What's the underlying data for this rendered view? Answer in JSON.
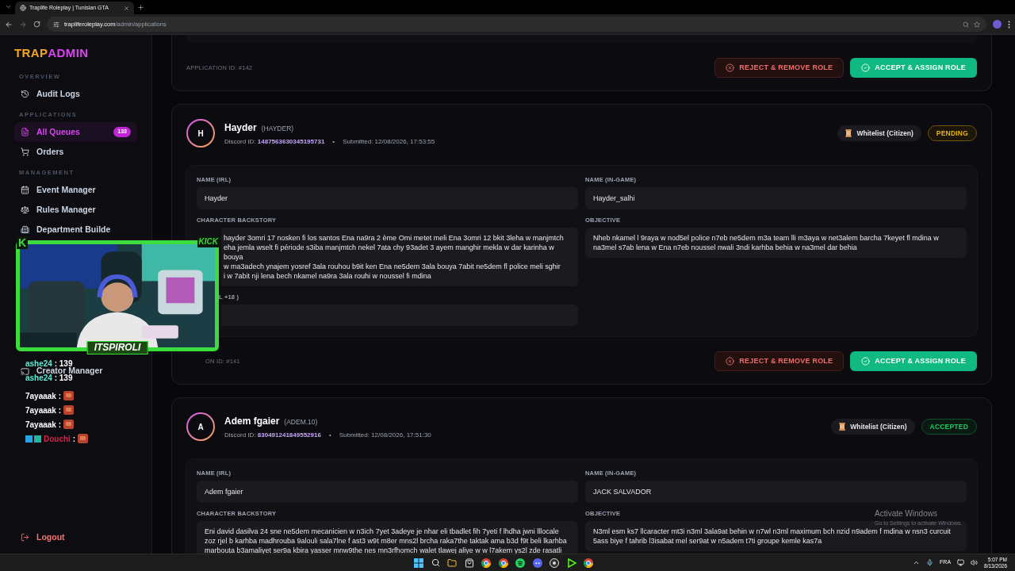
{
  "browser": {
    "tab_title": "Traplife Roleplay | Tunisian GTA",
    "url_host": "trapliferoleplay.com",
    "url_path": "/admin/applications"
  },
  "brand": {
    "part1": "TRAP",
    "part2": "ADMIN"
  },
  "sidebar": {
    "sections": [
      {
        "heading": "OVERVIEW",
        "items": [
          {
            "label": "Audit Logs",
            "selected": false
          }
        ]
      },
      {
        "heading": "APPLICATIONS",
        "items": [
          {
            "label": "All Queues",
            "selected": true,
            "badge": "133"
          },
          {
            "label": "Orders",
            "selected": false
          }
        ]
      },
      {
        "heading": "MANAGEMENT",
        "items": [
          {
            "label": "Event Manager",
            "selected": false
          },
          {
            "label": "Rules Manager",
            "selected": false
          },
          {
            "label": "Department Builde",
            "selected": false
          },
          {
            "label": "Creator Manager",
            "selected": false,
            "after_hidden": true
          }
        ]
      }
    ],
    "logout": "Logout"
  },
  "applications": [
    {
      "kind": "partial",
      "application_id": "APPLICATION ID: #142",
      "actions": {
        "reject": "REJECT & REMOVE ROLE",
        "accept": "ACCEPT & ASSIGN ROLE"
      }
    },
    {
      "kind": "full",
      "occluded": true,
      "initial": "H",
      "name": "Hayder",
      "handle": "(HAYDER)",
      "discord_label": "Discord ID:",
      "discord_id": "1487563630345195731",
      "separator": "•",
      "submitted": "Submitted: 12/08/2026, 17:53:55",
      "type": "Whitelist (Citizen)",
      "status": {
        "label": "PENDING",
        "kind": "pending"
      },
      "left": [
        {
          "label": "NAME (IRL)",
          "value": "Hayder",
          "multiline": false
        },
        {
          "label": "CHARACTER BACKSTORY",
          "value": "hayder 3omri 17 nosken fi los santos   Ena na9ra 2 ème Omi metet meli Ena 3omri 12 bkit 3leha w manjmtch\neha jemla wselt fi période s3iba manjmtch nekel 7ata chy 93adet 3 ayem manghir mekla w dar karinha w bouya\nw ma3adech ynajem yosref 3ala rouhou b9it ken Ena ne5dem 3ala bouya 7abit ne5dem fl police meli sghir\ni w 7abit nji lena bech nkamel na9ra 3ala rouhi w noussel fi mdina",
          "multiline": true,
          "occluded": true
        },
        {
          "label": "L +18 )",
          "occluded": true
        }
      ],
      "right": [
        {
          "label": "NAME (IN-GAME)",
          "value": "Hayder_salhi",
          "multiline": false
        },
        {
          "label": "OBJECTIVE",
          "value": "Nheb nkamel l 9raya w nod5el police n7eb ne5dem m3a team lli m3aya w net3alem barcha 7keyet fl mdina w na3mel s7ab lena w Ena n7eb noussel nwali 3ndi karhba behia w na3mel dar behia",
          "multiline": true
        }
      ],
      "application_id": "ON ID: #141",
      "actions": {
        "reject": "REJECT & REMOVE ROLE",
        "accept": "ACCEPT & ASSIGN ROLE"
      }
    },
    {
      "kind": "full",
      "initial": "A",
      "name": "Adem fgaier",
      "handle": "(ADEM.10)",
      "discord_label": "Discord ID:",
      "discord_id": "830491241849552916",
      "separator": "•",
      "submitted": "Submitted: 12/08/2026, 17:51:30",
      "type": "Whitelist (Citizen)",
      "status": {
        "label": "ACCEPTED",
        "kind": "accepted"
      },
      "left": [
        {
          "label": "NAME (IRL)",
          "value": "Adem fgaier",
          "multiline": false
        },
        {
          "label": "CHARACTER BACKSTORY",
          "value": "Eni david dasilva 24 sne ne5dem mecanicien w n3ich 7yet 3adeye je nhar eli tbadlet fih 7yeti f lhdha jwni lllocale zoz rjel b karhba madhrouba 9alouli sala7lne f ast3 w9t m8er mns2l brcha raka7the taktak ama b3d f9t beli lkarhba marbouta b3amaliyet ser9a kbira yasser mnw9the nes mn3rfhomch walet tlawej aliye w w l7akem ys2l zde  rasatli",
          "multiline": true
        }
      ],
      "right": [
        {
          "label": "NAME (IN-GAME)",
          "value": "JACK SALVADOR",
          "multiline": false
        },
        {
          "label": "OBJECTIVE",
          "value": "N3ml esm ks7 llcaracter mt3i n3ml 3ala9at behin w n7wl n3ml maximum bch nzid n9adem f mdina w nsn3 curcuit 5ass biye f tahrib l3isabat mel ser9at w n5adem t7ti groupe kemle kas7a",
          "multiline": true
        }
      ]
    }
  ],
  "stream_overlay": {
    "logo_left": "K",
    "logo_right": "KICK",
    "streamer": "ITSPIROLI",
    "chat": [
      {
        "kind": "text",
        "user": "ashe24",
        "message": ": 139",
        "color": "#5eead4"
      },
      {
        "kind": "text",
        "user": "ashe24",
        "message": ": 139",
        "color": "#5eead4"
      },
      {
        "kind": "emote",
        "user": "7ayaaak",
        "message": ":",
        "color": "#ffffff"
      },
      {
        "kind": "emote",
        "user": "7ayaaak",
        "message": ":",
        "color": "#ffffff"
      },
      {
        "kind": "emote",
        "user": "7ayaaak",
        "message": ":",
        "color": "#ffffff"
      },
      {
        "kind": "badged",
        "user": "Douchi",
        "message": ":",
        "color": "#e11d48"
      }
    ]
  },
  "os_notice": {
    "title": "Activate Windows",
    "text": "Go to Settings to activate Windows."
  },
  "taskbar": {
    "language": "FRA",
    "time": "5:07 PM",
    "date": "8/13/2026"
  }
}
